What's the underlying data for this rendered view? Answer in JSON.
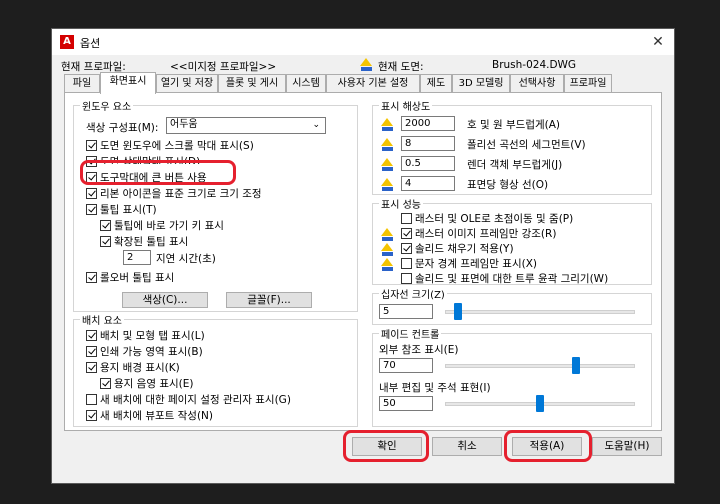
{
  "window": {
    "title": "옵션",
    "logo": "A"
  },
  "profile": {
    "current_profile_label": "현재 프로파일:",
    "current_profile_value": "<<미지정 프로파일>>",
    "current_drawing_label": "현재 도면:",
    "current_drawing_value": "Brush-024.DWG"
  },
  "tabs": [
    "파일",
    "화면표시",
    "열기 및 저장",
    "플롯 및 게시",
    "시스템",
    "사용자 기본 설정",
    "제도",
    "3D 모델링",
    "선택사항",
    "프로파일"
  ],
  "window_elements": {
    "title": "윈도우 요소",
    "color_scheme_label": "색상 구성표(M):",
    "color_scheme_value": "어두움",
    "items": [
      {
        "label": "도면 윈도우에 스크롤 막대 표시(S)",
        "checked": true
      },
      {
        "label": "도면 상태막대 표시(D)",
        "checked": true
      },
      {
        "label": "도구막대에 큰 버튼 사용",
        "checked": true
      },
      {
        "label": "리본 아이콘을 표준 크기로 크기 조정",
        "checked": true
      },
      {
        "label": "툴팁 표시(T)",
        "checked": true
      },
      {
        "label": "툴팁에 바로 가기 키 표시",
        "checked": true
      },
      {
        "label": "확장된 툴팁 표시",
        "checked": true
      },
      {
        "label": "롤오버 툴팁 표시",
        "checked": true
      }
    ],
    "delay_value": "2",
    "delay_label": "지연 시간(초)",
    "colors_button": "색상(C)...",
    "fonts_button": "글꼴(F)..."
  },
  "layout_elements": {
    "title": "배치 요소",
    "items": [
      {
        "label": "배치 및 모형 탭 표시(L)",
        "checked": true
      },
      {
        "label": "인쇄 가능 영역 표시(B)",
        "checked": true
      },
      {
        "label": "용지 배경 표시(K)",
        "checked": true
      },
      {
        "label": "용지 음영 표시(E)",
        "checked": true
      },
      {
        "label": "새 배치에 대한 페이지 설정 관리자 표시(G)",
        "checked": false
      },
      {
        "label": "새 배치에 뷰포트 작성(N)",
        "checked": true
      }
    ]
  },
  "display_resolution": {
    "title": "표시 해상도",
    "items": [
      {
        "value": "2000",
        "label": "호 및 원 부드럽게(A)"
      },
      {
        "value": "8",
        "label": "폴리선 곡선의 세그먼트(V)"
      },
      {
        "value": "0.5",
        "label": "렌더 객체 부드럽게(J)"
      },
      {
        "value": "4",
        "label": "표면당 형상 선(O)"
      }
    ]
  },
  "display_performance": {
    "title": "표시 성능",
    "items": [
      {
        "label": "래스터 및 OLE로 초점이동 및 줌(P)",
        "checked": false
      },
      {
        "label": "래스터 이미지 프레임만 강조(R)",
        "checked": true
      },
      {
        "label": "솔리드 채우기 적용(Y)",
        "checked": true
      },
      {
        "label": "문자 경계 프레임만 표시(X)",
        "checked": false
      },
      {
        "label": "솔리드 및 표면에 대한 트루 윤곽 그리기(W)",
        "checked": false
      }
    ]
  },
  "crosshair": {
    "title": "십자선 크기(Z)",
    "value": "5",
    "slider_fraction": 0.05
  },
  "fade": {
    "title": "페이드 컨트롤",
    "xref_label": "외부 참조 표시(E)",
    "xref_value": "70",
    "xref_fraction": 0.7,
    "inplace_label": "내부 편집 및 주석 표현(I)",
    "inplace_value": "50",
    "inplace_fraction": 0.5
  },
  "buttons": {
    "ok": "확인",
    "cancel": "취소",
    "apply": "적용(A)",
    "help": "도움말(H)"
  },
  "colors": {
    "highlight": "#e5202e",
    "accent": "#0078d7",
    "dialog_bg": "#f0f0f0"
  }
}
